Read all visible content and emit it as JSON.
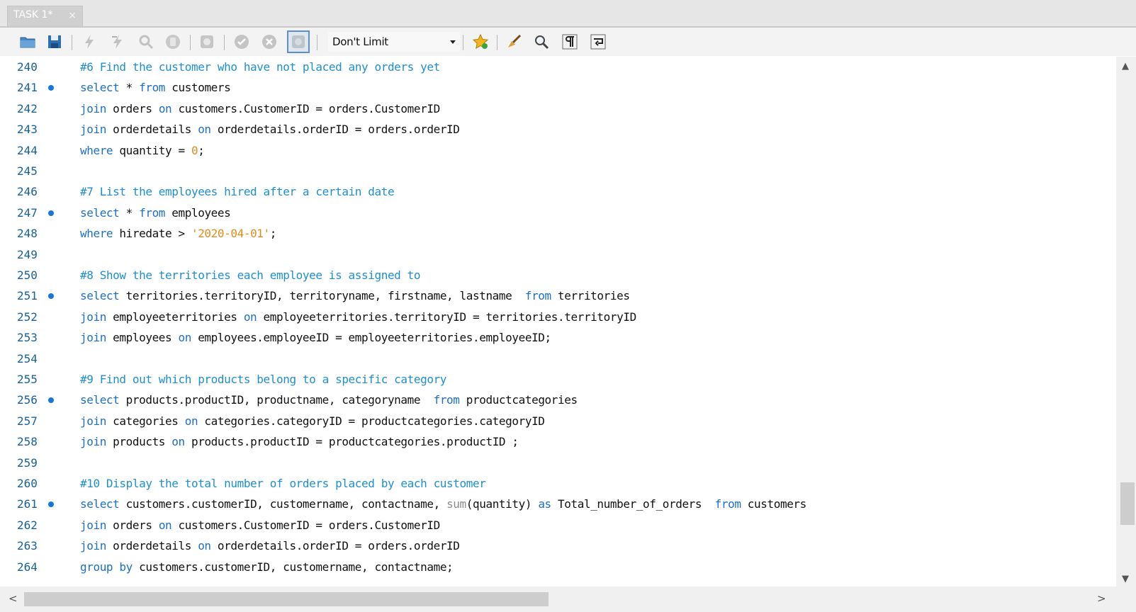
{
  "tab": {
    "label": "TASK 1*",
    "close": "×"
  },
  "toolbar": {
    "limit_select_value": "Don't Limit"
  },
  "editor": {
    "lines": [
      {
        "num": "240",
        "marker": false,
        "tokens": [
          [
            "cm",
            "#6 Find the customer who have not placed any orders yet"
          ]
        ]
      },
      {
        "num": "241",
        "marker": true,
        "tokens": [
          [
            "kw",
            "select"
          ],
          [
            "",
            " * "
          ],
          [
            "kw",
            "from"
          ],
          [
            "",
            " customers"
          ]
        ]
      },
      {
        "num": "242",
        "marker": false,
        "tokens": [
          [
            "kw",
            "join"
          ],
          [
            "",
            " orders "
          ],
          [
            "kw",
            "on"
          ],
          [
            "",
            " customers.CustomerID = orders.CustomerID"
          ]
        ]
      },
      {
        "num": "243",
        "marker": false,
        "tokens": [
          [
            "kw",
            "join"
          ],
          [
            "",
            " orderdetails "
          ],
          [
            "kw",
            "on"
          ],
          [
            "",
            " orderdetails.orderID = orders.orderID"
          ]
        ]
      },
      {
        "num": "244",
        "marker": false,
        "tokens": [
          [
            "kw",
            "where"
          ],
          [
            "",
            " quantity = "
          ],
          [
            "num",
            "0"
          ],
          [
            "",
            ";"
          ]
        ]
      },
      {
        "num": "245",
        "marker": false,
        "tokens": []
      },
      {
        "num": "246",
        "marker": false,
        "tokens": [
          [
            "cm",
            "#7 List the employees hired after a certain date"
          ]
        ]
      },
      {
        "num": "247",
        "marker": true,
        "tokens": [
          [
            "kw",
            "select"
          ],
          [
            "",
            " * "
          ],
          [
            "kw",
            "from"
          ],
          [
            "",
            " employees"
          ]
        ]
      },
      {
        "num": "248",
        "marker": false,
        "tokens": [
          [
            "kw",
            "where"
          ],
          [
            "",
            " hiredate > "
          ],
          [
            "str",
            "'2020-04-01'"
          ],
          [
            "",
            ";"
          ]
        ]
      },
      {
        "num": "249",
        "marker": false,
        "tokens": []
      },
      {
        "num": "250",
        "marker": false,
        "tokens": [
          [
            "cm",
            "#8 Show the territories each employee is assigned to"
          ]
        ]
      },
      {
        "num": "251",
        "marker": true,
        "tokens": [
          [
            "kw",
            "select"
          ],
          [
            "",
            " territories.territoryID, territoryname, firstname, lastname  "
          ],
          [
            "kw",
            "from"
          ],
          [
            "",
            " territories"
          ]
        ]
      },
      {
        "num": "252",
        "marker": false,
        "tokens": [
          [
            "kw",
            "join"
          ],
          [
            "",
            " employeeterritories "
          ],
          [
            "kw",
            "on"
          ],
          [
            "",
            " employeeterritories.territoryID = territories.territoryID"
          ]
        ]
      },
      {
        "num": "253",
        "marker": false,
        "tokens": [
          [
            "kw",
            "join"
          ],
          [
            "",
            " employees "
          ],
          [
            "kw",
            "on"
          ],
          [
            "",
            " employees.employeeID = employeeterritories.employeeID;"
          ]
        ]
      },
      {
        "num": "254",
        "marker": false,
        "tokens": []
      },
      {
        "num": "255",
        "marker": false,
        "tokens": [
          [
            "cm",
            "#9 Find out which products belong to a specific category"
          ]
        ]
      },
      {
        "num": "256",
        "marker": true,
        "tokens": [
          [
            "kw",
            "select"
          ],
          [
            "",
            " products.productID, productname, categoryname  "
          ],
          [
            "kw",
            "from"
          ],
          [
            "",
            " productcategories"
          ]
        ]
      },
      {
        "num": "257",
        "marker": false,
        "tokens": [
          [
            "kw",
            "join"
          ],
          [
            "",
            " categories "
          ],
          [
            "kw",
            "on"
          ],
          [
            "",
            " categories.categoryID = productcategories.categoryID"
          ]
        ]
      },
      {
        "num": "258",
        "marker": false,
        "tokens": [
          [
            "kw",
            "join"
          ],
          [
            "",
            " products "
          ],
          [
            "kw",
            "on"
          ],
          [
            "",
            " products.productID = productcategories.productID ;"
          ]
        ]
      },
      {
        "num": "259",
        "marker": false,
        "tokens": []
      },
      {
        "num": "260",
        "marker": false,
        "tokens": [
          [
            "cm",
            "#10 Display the total number of orders placed by each customer"
          ]
        ]
      },
      {
        "num": "261",
        "marker": true,
        "tokens": [
          [
            "kw",
            "select"
          ],
          [
            "",
            " customers.customerID, customername, contactname, "
          ],
          [
            "fn",
            "sum"
          ],
          [
            "",
            "(quantity) "
          ],
          [
            "kw",
            "as"
          ],
          [
            "",
            " Total_number_of_orders  "
          ],
          [
            "kw",
            "from"
          ],
          [
            "",
            " customers"
          ]
        ]
      },
      {
        "num": "262",
        "marker": false,
        "tokens": [
          [
            "kw",
            "join"
          ],
          [
            "",
            " orders "
          ],
          [
            "kw",
            "on"
          ],
          [
            "",
            " customers.CustomerID = orders.CustomerID"
          ]
        ]
      },
      {
        "num": "263",
        "marker": false,
        "tokens": [
          [
            "kw",
            "join"
          ],
          [
            "",
            " orderdetails "
          ],
          [
            "kw",
            "on"
          ],
          [
            "",
            " orderdetails.orderID = orders.orderID"
          ]
        ]
      },
      {
        "num": "264",
        "marker": false,
        "tokens": [
          [
            "kw",
            "group by"
          ],
          [
            "",
            " customers.customerID, customername, contactname;"
          ]
        ]
      }
    ]
  },
  "scrollbars": {
    "up": "▲",
    "down": "▼",
    "left": "<",
    "right": ">"
  }
}
